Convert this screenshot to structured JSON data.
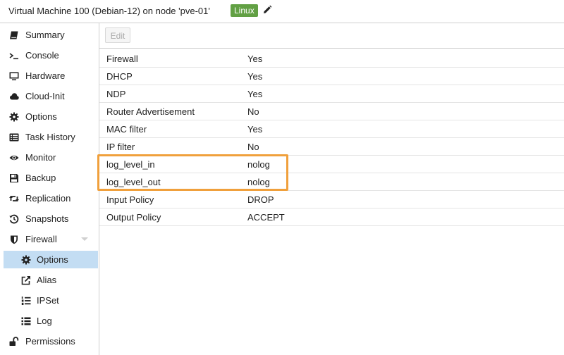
{
  "header": {
    "title": "Virtual Machine 100 (Debian-12) on node 'pve-01'",
    "tag": "Linux",
    "tag_color": "#62a044",
    "edit_icon": "pencil-icon"
  },
  "sidebar": {
    "items": [
      {
        "label": "Summary",
        "icon": "book-icon"
      },
      {
        "label": "Console",
        "icon": "terminal-icon"
      },
      {
        "label": "Hardware",
        "icon": "monitor-icon"
      },
      {
        "label": "Cloud-Init",
        "icon": "cloud-icon"
      },
      {
        "label": "Options",
        "icon": "gear-icon"
      },
      {
        "label": "Task History",
        "icon": "list-icon"
      },
      {
        "label": "Monitor",
        "icon": "eye-icon"
      },
      {
        "label": "Backup",
        "icon": "floppy-icon"
      },
      {
        "label": "Replication",
        "icon": "retweet-icon"
      },
      {
        "label": "Snapshots",
        "icon": "history-icon"
      },
      {
        "label": "Firewall",
        "icon": "shield-icon",
        "expanded": true
      },
      {
        "label": "Options",
        "icon": "gear-icon",
        "selected": true
      },
      {
        "label": "Alias",
        "icon": "external-link-icon"
      },
      {
        "label": "IPSet",
        "icon": "list-ol-icon"
      },
      {
        "label": "Log",
        "icon": "list-icon"
      },
      {
        "label": "Permissions",
        "icon": "unlock-icon"
      }
    ],
    "selected_bg": "#c3ddf3"
  },
  "toolbar": {
    "edit_label": "Edit",
    "edit_disabled": true
  },
  "options": {
    "rows": [
      {
        "key": "Firewall",
        "value": "Yes"
      },
      {
        "key": "DHCP",
        "value": "Yes"
      },
      {
        "key": "NDP",
        "value": "Yes"
      },
      {
        "key": "Router Advertisement",
        "value": "No"
      },
      {
        "key": "MAC filter",
        "value": "Yes"
      },
      {
        "key": "IP filter",
        "value": "No"
      },
      {
        "key": "log_level_in",
        "value": "nolog",
        "highlighted": true
      },
      {
        "key": "log_level_out",
        "value": "nolog",
        "highlighted": true
      },
      {
        "key": "Input Policy",
        "value": "DROP"
      },
      {
        "key": "Output Policy",
        "value": "ACCEPT"
      }
    ],
    "highlight_color": "#f0a03c"
  }
}
